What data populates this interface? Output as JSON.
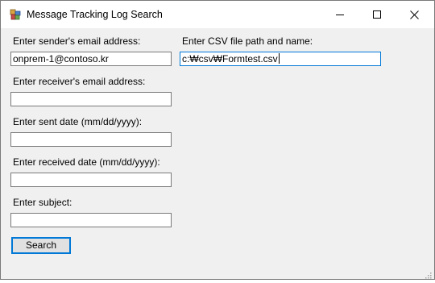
{
  "window": {
    "title": "Message Tracking Log Search",
    "icon": "winforms-app-icon",
    "controls": {
      "minimize_icon": "minimize-icon",
      "maximize_icon": "maximize-icon",
      "close_icon": "close-icon"
    }
  },
  "form": {
    "sender": {
      "label": "Enter sender's email address:",
      "value": "onprem-1@contoso.kr"
    },
    "receiver": {
      "label": "Enter receiver's email address:",
      "value": ""
    },
    "sent_date": {
      "label": "Enter sent date (mm/dd/yyyy):",
      "value": ""
    },
    "received_date": {
      "label": "Enter received date (mm/dd/yyyy):",
      "value": ""
    },
    "subject": {
      "label": "Enter subject:",
      "value": ""
    },
    "csv_path": {
      "label": "Enter CSV file path and name:",
      "value": "c:₩csv₩Formtest.csv"
    },
    "search_button": {
      "label": "Search"
    }
  },
  "colors": {
    "focus_accent": "#0078d7",
    "window_background": "#f0f0f0",
    "titlebar_background": "#ffffff"
  }
}
